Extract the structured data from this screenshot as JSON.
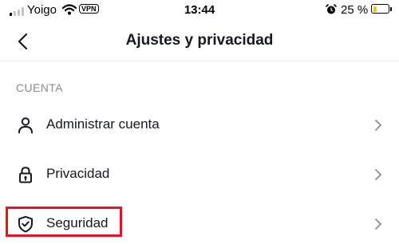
{
  "status_bar": {
    "carrier": "Yoigo",
    "vpn_label": "VPN",
    "time": "13:44",
    "battery_percent": "25 %",
    "battery_level": 0.25,
    "battery_color": "#f5c518",
    "icons": [
      "signal-icon",
      "wifi-icon",
      "alarm-icon",
      "battery-icon"
    ]
  },
  "nav": {
    "title": "Ajustes y privacidad",
    "back_icon": "chevron-left-icon"
  },
  "section": {
    "header": "CUENTA",
    "items": [
      {
        "label": "Administrar cuenta",
        "icon": "person-icon"
      },
      {
        "label": "Privacidad",
        "icon": "lock-icon"
      },
      {
        "label": "Seguridad",
        "icon": "shield-check-icon",
        "highlighted": true
      }
    ]
  },
  "colors": {
    "highlight": "#e8141c",
    "text": "#161823",
    "muted": "#8a8b91",
    "chevron": "#8a8b91"
  }
}
